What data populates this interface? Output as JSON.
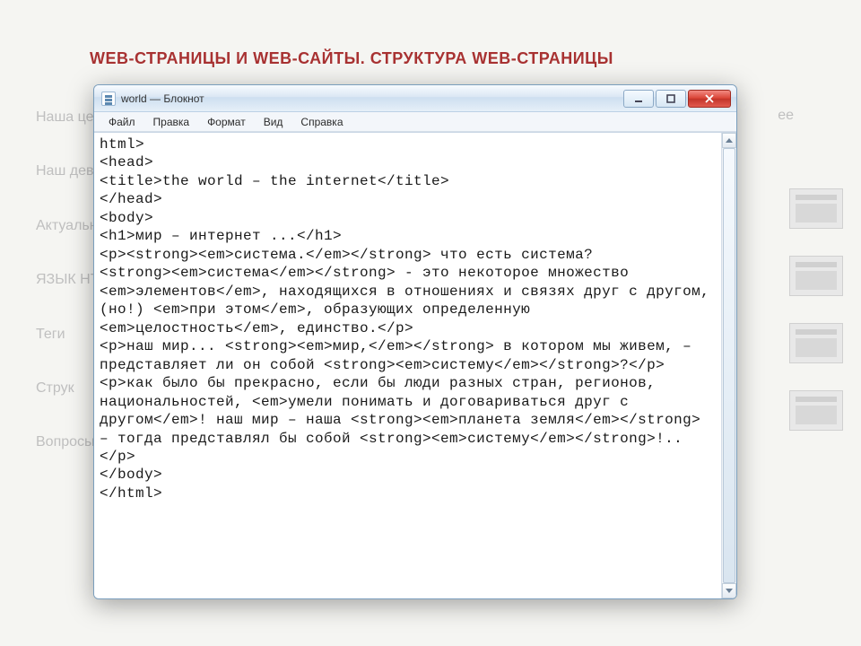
{
  "slide": {
    "title": "WEB-СТРАНИЦЫ И WEB-САЙТЫ. СТРУКТУРА WEB-СТРАНИЦЫ",
    "bg_items": [
      "Наша це",
      "Наш дев",
      "Актуальн",
      "ЯЗЫК HT",
      "Теги",
      "Струк",
      "Вопросы"
    ],
    "trail": "ее"
  },
  "window": {
    "title": "world — Блокнот",
    "menu": {
      "file": "Файл",
      "edit": "Правка",
      "format": "Формат",
      "view": "Вид",
      "help": "Справка"
    },
    "buttons": {
      "minimize": "_",
      "maximize": "□",
      "close": "×"
    }
  },
  "editor": {
    "content": "html>\n<HEAD>\n<title>The World – The Internet</title>\n</head>\n<body>\n<H1>Мир – Интернет ...</H1>\n<p><strong><em>Система.</em></strong> Что есть система?\n<strong><em>Система</em></strong> - это некоторое множество <em>элементов</em>, находящихся в отношениях и связях друг с другом, (но!) <em>при этом</em>, образующих определенную <em>целостность</em>, единство.</p>\n<p>Наш мир... <strong><em>Мир,</em></strong> в котором мы живем, – представляет ли он собой <strong><em>систему</em></strong>?</p>\n<p>Как было бы прекрасно, если бы люди разных стран, регионов, национальностей, <em>умели понимать и договариваться друг с другом</em>! Наш мир – наша <strong><em>планета Земля</em></strong> – тогда представлял бы собой <strong><em>систему</em></strong>!..</p>\n</body>\n</html>"
  }
}
